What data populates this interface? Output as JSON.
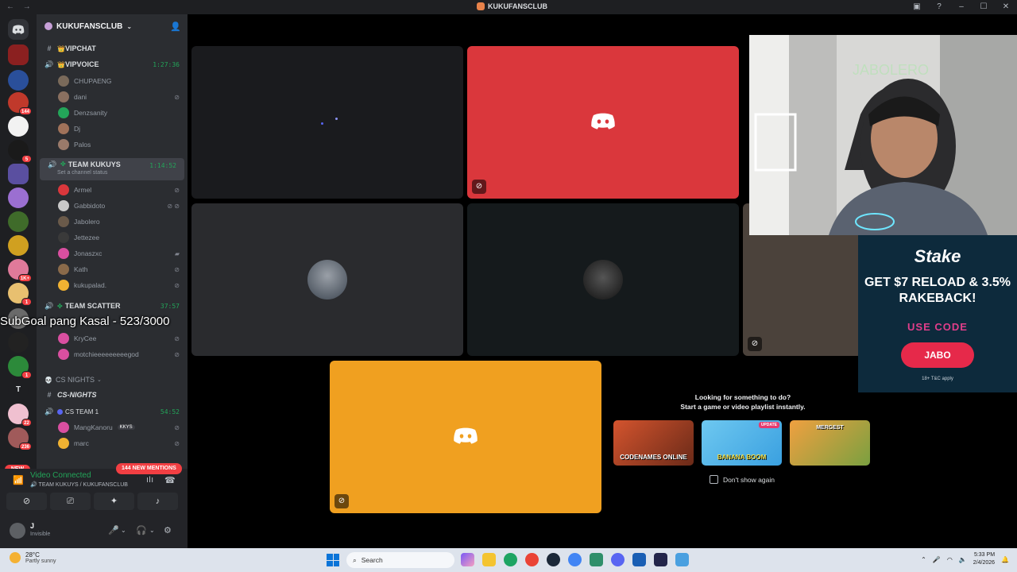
{
  "window": {
    "title": "KUKUFANSCLUB"
  },
  "server": {
    "name": "KUKUFANSCLUB"
  },
  "guild_badges": [
    "144",
    "5",
    "1K+",
    "1",
    "1",
    "22",
    "236"
  ],
  "guild_letter": "T",
  "new_label": "NEW",
  "channels": {
    "vipchat": "VIPCHAT",
    "vipvoice": {
      "name": "VIPVOICE",
      "time": "1:27:36",
      "users": [
        "CHUPAENG",
        "dani",
        "Denzsanity",
        "Dj",
        "Palos"
      ]
    },
    "teamkukuys": {
      "name": "TEAM KUKUYS",
      "time": "1:14:52",
      "status": "Set a channel status",
      "users": [
        "Armel",
        "Gabbidoto",
        "Jabolero",
        "Jettezee",
        "Jonaszxc",
        "Kath",
        "kukupalad."
      ]
    },
    "teamscatter": {
      "name": "TEAM SCATTER",
      "time": "37:57",
      "users": [
        "KryCee",
        "motchieeeeeeeeegod"
      ]
    },
    "csnights_cat": "CS NIGHTS",
    "csnights": "CS-NIGHTS",
    "csteam1": {
      "name": "CS TEAM 1",
      "time": "54:52",
      "users": [
        "MangKanoru",
        "marc"
      ],
      "tag": "KKYS"
    }
  },
  "overlay_text": "SubGoal pang Kasal - 523/3000",
  "mentions_pill": "144 NEW MENTIONS",
  "rtc": {
    "status": "Video Connected",
    "sub": "TEAM KUKUYS / KUKUFANSCLUB"
  },
  "user": {
    "name": "J",
    "status": "Invisible"
  },
  "activity": {
    "heading": "Looking for something to do?",
    "subheading": "Start a game or video playlist instantly.",
    "games": [
      "CODENAMES ONLINE",
      "BANANA BOOM",
      "MERGEST"
    ],
    "update_badge": "UPDATE",
    "dont_show": "Don't show again"
  },
  "ad": {
    "brand": "Stake",
    "headline": "GET $7 RELOAD & 3.5% RAKEBACK!",
    "use_code": "USE CODE",
    "code": "JABO",
    "tc": "18+ T&C apply"
  },
  "webcam_sign": "JABOLERO",
  "taskbar": {
    "temp": "28°C",
    "condition": "Partly sunny",
    "search": "Search",
    "time": "5:33 PM",
    "date": "2/4/2026"
  },
  "colors": {
    "tile_red": "#da373c",
    "tile_orange": "#f0a020",
    "accent_green": "#23a559",
    "mention_red": "#f23f43"
  }
}
